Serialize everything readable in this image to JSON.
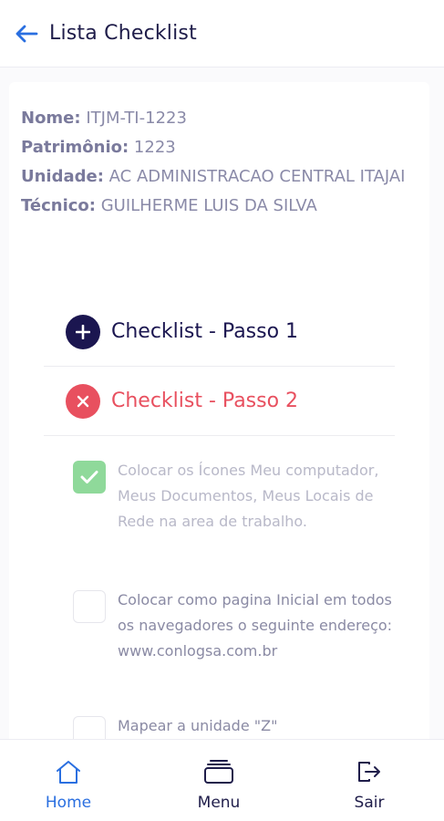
{
  "header": {
    "title": "Lista Checklist",
    "back_icon": "arrow-left-icon"
  },
  "info": {
    "nome": {
      "key": "Nome:",
      "value": "ITJM-TI-1223"
    },
    "patrimonio": {
      "key": "Patrimônio:",
      "value": "1223"
    },
    "unidade": {
      "key": "Unidade:",
      "value": "AC ADMINISTRACAO CENTRAL ITAJAI"
    },
    "tecnico": {
      "key": "Técnico:",
      "value": "GUILHERME LUIS DA SILVA"
    }
  },
  "steps": [
    {
      "label": "Checklist - Passo 1",
      "icon": "plus-circle-icon",
      "color": "#1b1650"
    },
    {
      "label": "Checklist - Passo 2",
      "icon": "close-circle-icon",
      "color": "#e8505f"
    }
  ],
  "items": [
    {
      "text": "Colocar os Ícones Meu computador, Meus Documentos, Meus Locais de Rede na area de trabalho.",
      "checked": true
    },
    {
      "text": "Colocar como pagina Inicial em todos os navegadores o seguinte endereço: www.conlogsa.com.br",
      "checked": false
    },
    {
      "text": "Mapear a unidade \"Z\"",
      "checked": false
    }
  ],
  "nav": {
    "home": {
      "label": "Home",
      "icon": "home-icon",
      "active": true
    },
    "menu": {
      "label": "Menu",
      "icon": "menu-icon"
    },
    "sair": {
      "label": "Sair",
      "icon": "logout-icon"
    }
  },
  "colors": {
    "accent": "#2a6fe0",
    "dark": "#1b1650",
    "danger": "#e8505f",
    "success": "#8fd99a"
  }
}
